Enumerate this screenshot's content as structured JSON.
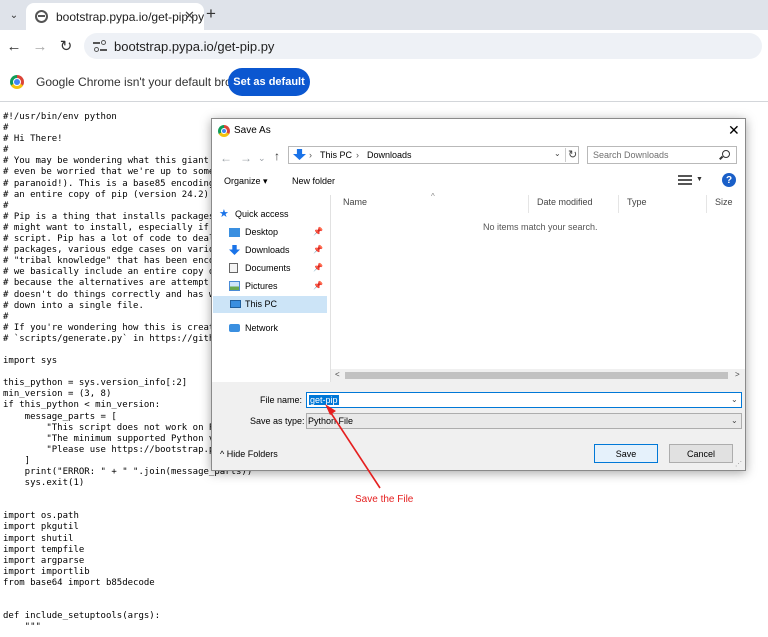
{
  "browser": {
    "tab_title": "bootstrap.pypa.io/get-pip.py",
    "tab_menu_glyph": "⌄",
    "tab_close_glyph": "✕",
    "new_tab_glyph": "+",
    "url": "bootstrap.pypa.io/get-pip.py",
    "back_glyph": "←",
    "forward_glyph": "→",
    "reload_glyph": "↻"
  },
  "infobar": {
    "message": "Google Chrome isn't your default browser",
    "button_label": "Set as default"
  },
  "code_lines": [
    "#!/usr/bin/env python",
    "#",
    "# Hi There!",
    "#",
    "# You may be wondering what this giant",
    "# even be worried that we're up to some",
    "# paranoid!). This is a base85 encoding",
    "# an entire copy of pip (version 24.2).",
    "#",
    "# Pip is a thing that installs packages",
    "# might want to install, especially if",
    "# script. Pip has a lot of code to deal",
    "# packages, various edge cases on vario",
    "# \"tribal knowledge\" that has been enco",
    "# we basically include an entire copy o",
    "# because the alternatives are attempt",
    "# doesn't do things correctly and has w",
    "# down into a single file.",
    "#",
    "# If you're wondering how this is creat",
    "# `scripts/generate.py` in https://gith",
    "",
    "import sys",
    "",
    "this_python = sys.version_info[:2]",
    "min_version = (3, 8)",
    "if this_python < min_version:",
    "    message_parts = [",
    "        \"This script does not work on P",
    "        \"The minimum supported Python v",
    "        \"Please use https://bootstrap.p",
    "    ]",
    "    print(\"ERROR: \" + \" \".join(message_parts))",
    "    sys.exit(1)",
    "",
    "",
    "import os.path",
    "import pkgutil",
    "import shutil",
    "import tempfile",
    "import argparse",
    "import importlib",
    "from base64 import b85decode",
    "",
    "",
    "def include_setuptools(args):",
    "    \"\"\""
  ],
  "dialog": {
    "title": "Save As",
    "close_glyph": "✕",
    "nav": {
      "back": "←",
      "forward": "→",
      "down": "⌄",
      "up": "↑"
    },
    "breadcrumb": [
      "This PC",
      "Downloads"
    ],
    "breadcrumb_sep": "›",
    "dropdown_glyph": "⌄",
    "refresh_glyph": "↻",
    "search_placeholder": "Search Downloads",
    "organize_label": "Organize ▾",
    "new_folder_label": "New folder",
    "view_dd_glyph": "▼",
    "help_glyph": "?",
    "pin_glyph": "📌",
    "nav_items": {
      "quick_access": "Quick access",
      "desktop": "Desktop",
      "downloads": "Downloads",
      "documents": "Documents",
      "pictures": "Pictures",
      "this_pc": "This PC",
      "network": "Network"
    },
    "columns": [
      "Name",
      "Date modified",
      "Type",
      "Size"
    ],
    "sort_glyph": "^",
    "empty_message": "No items match your search.",
    "scroll_left": "<",
    "scroll_right": ">",
    "file_name_label": "File name:",
    "file_name_value": "get-pip",
    "save_as_type_label": "Save as type:",
    "save_as_type_value": "Python File",
    "hide_folders_label": "^   Hide Folders",
    "save_label": "Save",
    "cancel_label": "Cancel",
    "grip_glyph": "⋰"
  },
  "annotation": {
    "text": "Save the File",
    "color": "#e52020"
  },
  "colors": {
    "accent": "#0b57d0",
    "selection": "#0078d7"
  }
}
